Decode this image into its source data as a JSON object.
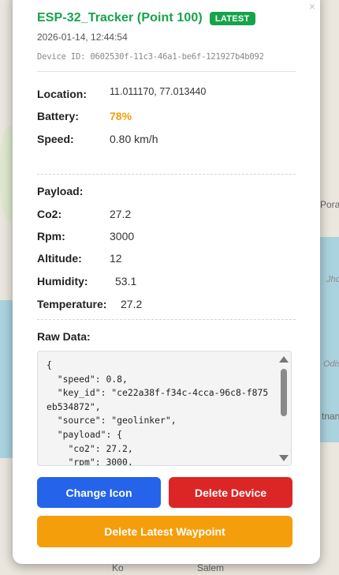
{
  "map": {
    "labels": [
      "Pora",
      "Odis",
      "Jho",
      "tnan",
      "Salem",
      "Ko"
    ],
    "colors": {
      "land": "#ebe6de",
      "water": "#aad3df",
      "forest": "#dfe8cf"
    }
  },
  "popup": {
    "close_icon": "×",
    "title": "ESP-32_Tracker (Point 100)",
    "badge": "LATEST",
    "timestamp": "2026-01-14, 12:44:54",
    "device_id": "Device ID: 0602530f-11c3-46a1-be6f-121927b4b092",
    "location": {
      "label": "Location:",
      "value": "11.011170, 77.013440"
    },
    "battery": {
      "label": "Battery:",
      "value": "78%"
    },
    "speed": {
      "label": "Speed:",
      "value": "0.80 km/h"
    },
    "payload_heading": "Payload:",
    "payload": [
      {
        "label": "Co2:",
        "value": "27.2"
      },
      {
        "label": "Rpm:",
        "value": "3000"
      },
      {
        "label": "Altitude:",
        "value": "12"
      },
      {
        "label": "Humidity:",
        "value": "53.1"
      },
      {
        "label": "Temperature:",
        "value": "27.2"
      }
    ],
    "raw_heading": "Raw Data:",
    "raw_data": "{\n  \"speed\": 0.8,\n  \"key_id\": \"ce22a38f-f34c-4cca-96c8-f875eb534872\",\n  \"source\": \"geolinker\",\n  \"payload\": {\n    \"co2\": 27.2,\n    \"rpm\": 3000,",
    "buttons": {
      "change_icon": "Change Icon",
      "delete_device": "Delete Device",
      "delete_waypoint": "Delete Latest Waypoint"
    },
    "colors": {
      "title": "#16a34a",
      "battery": "#f59e0b",
      "blue": "#2563eb",
      "red": "#dc2626",
      "orange": "#f59e0b"
    }
  }
}
